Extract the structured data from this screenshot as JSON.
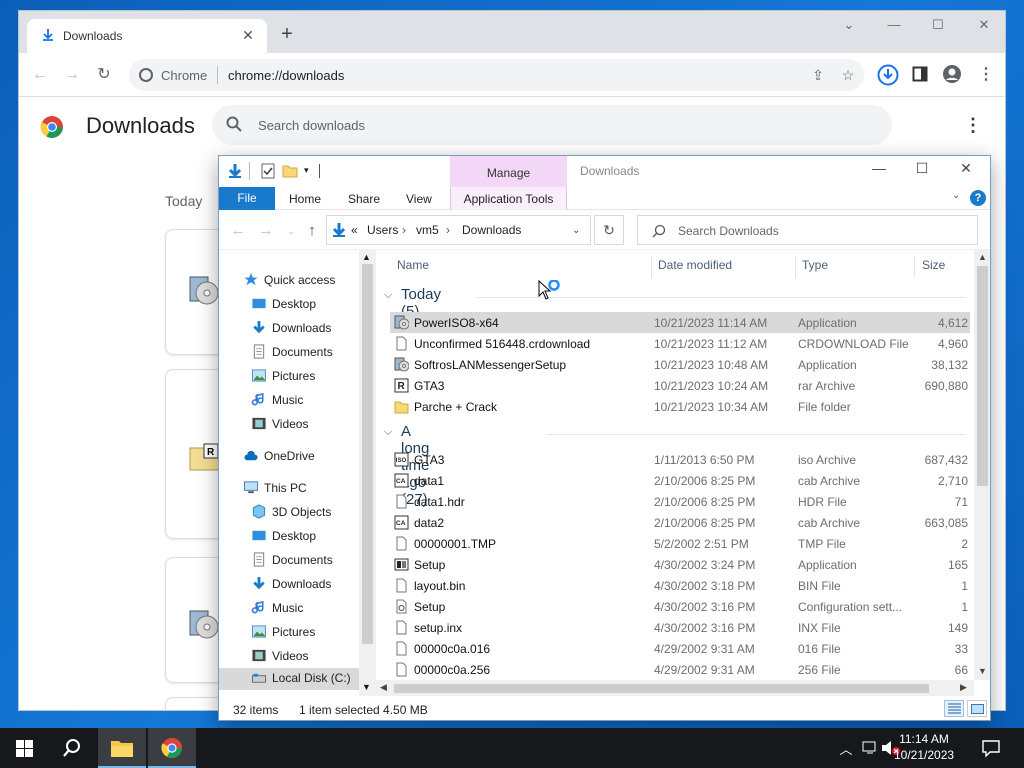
{
  "chrome": {
    "tab_title": "Downloads",
    "omnibox_site": "Chrome",
    "omnibox_url": "chrome://downloads",
    "page_title": "Downloads",
    "search_placeholder": "Search downloads",
    "today_label": "Today"
  },
  "explorer": {
    "window_title": "Downloads",
    "manage_label": "Manage",
    "ribbon_tabs": [
      "File",
      "Home",
      "Share",
      "View",
      "Application Tools"
    ],
    "breadcrumb": [
      "«",
      "Users",
      "vm5",
      "Downloads"
    ],
    "search_placeholder": "Search Downloads",
    "nav": {
      "quick_access": "Quick access",
      "qa_items": [
        "Desktop",
        "Downloads",
        "Documents",
        "Pictures",
        "Music",
        "Videos"
      ],
      "onedrive": "OneDrive",
      "this_pc": "This PC",
      "pc_items": [
        "3D Objects",
        "Desktop",
        "Documents",
        "Downloads",
        "Music",
        "Pictures",
        "Videos",
        "Local Disk (C:)"
      ]
    },
    "columns": [
      "Name",
      "Date modified",
      "Type",
      "Size"
    ],
    "groups": [
      {
        "label": "Today (5)",
        "rows": [
          {
            "name": "PowerISO8-x64",
            "date": "10/21/2023 11:14 AM",
            "type": "Application",
            "size": "4,612",
            "icon": "poweriso-icon",
            "selected": true
          },
          {
            "name": "Unconfirmed 516448.crdownload",
            "date": "10/21/2023 11:12 AM",
            "type": "CRDOWNLOAD File",
            "size": "4,960",
            "icon": "blank-file-icon"
          },
          {
            "name": "SoftrosLANMessengerSetup",
            "date": "10/21/2023 10:48 AM",
            "type": "Application",
            "size": "38,132",
            "icon": "installer-icon"
          },
          {
            "name": "GTA3",
            "date": "10/21/2023 10:24 AM",
            "type": "rar Archive",
            "size": "690,880",
            "icon": "rar-icon"
          },
          {
            "name": "Parche + Crack",
            "date": "10/21/2023 10:34 AM",
            "type": "File folder",
            "size": "",
            "icon": "folder-icon"
          }
        ]
      },
      {
        "label": "A long time ago (27)",
        "rows": [
          {
            "name": "GTA3",
            "date": "1/11/2013 6:50 PM",
            "type": "iso Archive",
            "size": "687,432",
            "icon": "iso-icon"
          },
          {
            "name": "data1",
            "date": "2/10/2006 8:25 PM",
            "type": "cab Archive",
            "size": "2,710",
            "icon": "cab-icon"
          },
          {
            "name": "data1.hdr",
            "date": "2/10/2006 8:25 PM",
            "type": "HDR File",
            "size": "71",
            "icon": "blank-file-icon"
          },
          {
            "name": "data2",
            "date": "2/10/2006 8:25 PM",
            "type": "cab Archive",
            "size": "663,085",
            "icon": "cab-icon"
          },
          {
            "name": "00000001.TMP",
            "date": "5/2/2002 2:51 PM",
            "type": "TMP File",
            "size": "2",
            "icon": "blank-file-icon"
          },
          {
            "name": "Setup",
            "date": "4/30/2002 3:24 PM",
            "type": "Application",
            "size": "165",
            "icon": "setup-exe-icon"
          },
          {
            "name": "layout.bin",
            "date": "4/30/2002 3:18 PM",
            "type": "BIN File",
            "size": "1",
            "icon": "blank-file-icon"
          },
          {
            "name": "Setup",
            "date": "4/30/2002 3:16 PM",
            "type": "Configuration sett...",
            "size": "1",
            "icon": "config-file-icon"
          },
          {
            "name": "setup.inx",
            "date": "4/30/2002 3:16 PM",
            "type": "INX File",
            "size": "149",
            "icon": "blank-file-icon"
          },
          {
            "name": "00000c0a.016",
            "date": "4/29/2002 9:31 AM",
            "type": "016 File",
            "size": "33",
            "icon": "blank-file-icon"
          },
          {
            "name": "00000c0a.256",
            "date": "4/29/2002 9:31 AM",
            "type": "256 File",
            "size": "66",
            "icon": "blank-file-icon"
          }
        ]
      }
    ],
    "status": {
      "items": "32 items",
      "selected": "1 item selected  4.50 MB"
    }
  },
  "taskbar": {
    "time": "11:14 AM",
    "date": "10/21/2023"
  }
}
